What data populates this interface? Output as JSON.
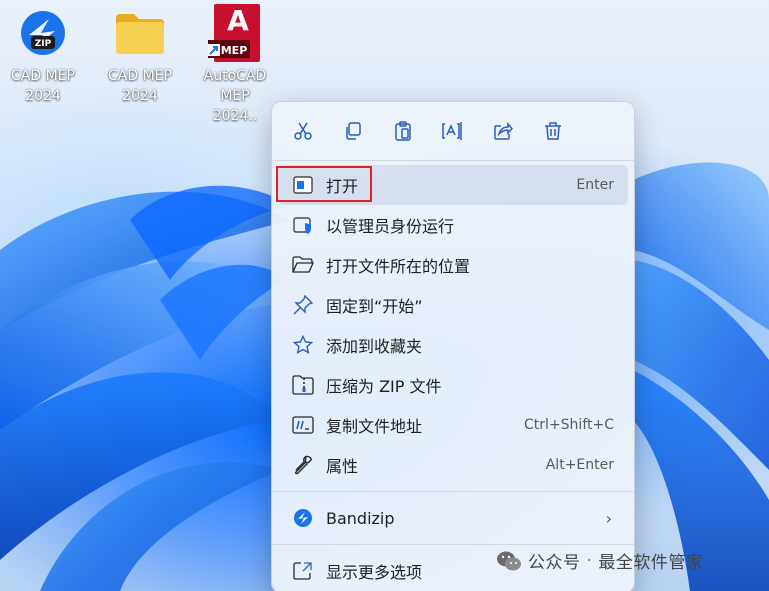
{
  "desktop": {
    "icons": [
      {
        "label": "CAD MEP\n2024",
        "icon": "zip-archive-icon"
      },
      {
        "label": "CAD MEP\n2024",
        "icon": "folder-icon"
      },
      {
        "label": "AutoCAD\nMEP 2024..",
        "icon": "autocad-mep-icon",
        "badge_letter": "A",
        "badge_text": "MEP"
      }
    ]
  },
  "context_menu": {
    "toolbar": [
      {
        "name": "cut",
        "icon": "scissors-icon"
      },
      {
        "name": "copy",
        "icon": "copy-icon"
      },
      {
        "name": "paste",
        "icon": "paste-icon"
      },
      {
        "name": "rename",
        "icon": "rename-icon"
      },
      {
        "name": "share",
        "icon": "share-icon"
      },
      {
        "name": "delete",
        "icon": "trash-icon"
      }
    ],
    "items": [
      {
        "label": "打开",
        "shortcut": "Enter",
        "icon": "open-app-icon"
      },
      {
        "label": "以管理员身份运行",
        "shortcut": "",
        "icon": "admin-shield-icon"
      },
      {
        "label": "打开文件所在的位置",
        "shortcut": "",
        "icon": "folder-open-icon"
      },
      {
        "label": "固定到“开始”",
        "shortcut": "",
        "icon": "pin-icon"
      },
      {
        "label": "添加到收藏夹",
        "shortcut": "",
        "icon": "star-icon"
      },
      {
        "label": "压缩为 ZIP 文件",
        "shortcut": "",
        "icon": "zip-folder-icon"
      },
      {
        "label": "复制文件地址",
        "shortcut": "Ctrl+Shift+C",
        "icon": "copy-path-icon"
      },
      {
        "label": "属性",
        "shortcut": "Alt+Enter",
        "icon": "wrench-icon"
      }
    ],
    "bandizip": {
      "label": "Bandizip",
      "icon": "bandizip-icon"
    },
    "more": {
      "label": "显示更多选项",
      "icon": "show-more-icon"
    }
  },
  "watermark": {
    "left": "公众号",
    "separator": "·",
    "right": "最全软件管家"
  },
  "colors": {
    "accent": "#0067c0",
    "highlight": "#e0232b",
    "autocad_red": "#c8102e",
    "folder_yellow": "#f4c542"
  }
}
